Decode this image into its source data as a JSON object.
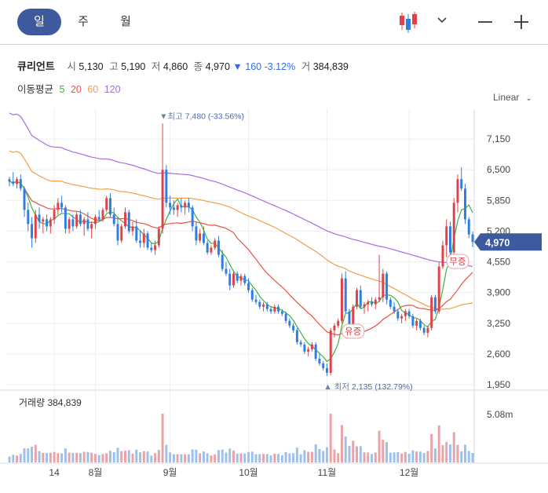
{
  "tabs": [
    {
      "id": "day",
      "label": "일",
      "active": true
    },
    {
      "id": "week",
      "label": "주",
      "active": false
    },
    {
      "id": "month",
      "label": "월",
      "active": false
    }
  ],
  "toolbar": {
    "chart_type_icon": "candlestick-icon",
    "dropdown_icon": "chevron-down-icon",
    "minus_icon": "minus-icon",
    "plus_icon": "plus-icon"
  },
  "stock": {
    "name": "큐리언트",
    "open_label": "시",
    "open": "5,130",
    "high_label": "고",
    "high": "5,190",
    "low_label": "저",
    "low": "4,860",
    "close_label": "종",
    "close": "4,970",
    "change_arrow": "▼",
    "change": "160",
    "change_pct": "-3.12%",
    "volume_label": "거",
    "volume": "384,839"
  },
  "moving_average": {
    "label": "이동평균",
    "periods": [
      {
        "period": "5",
        "color": "#3cb33c"
      },
      {
        "period": "20",
        "color": "#e8533f"
      },
      {
        "period": "60",
        "color": "#f0a048"
      },
      {
        "period": "120",
        "color": "#a96be0"
      }
    ]
  },
  "scale_mode": "Linear",
  "colors": {
    "up": "#e0424b",
    "down": "#2f7de1",
    "badge": "#3d5a9e",
    "grid": "#eceef1"
  },
  "chart_data": {
    "type": "candlestick",
    "price_axis": {
      "ticks": [
        "7,150",
        "6,500",
        "5,850",
        "5,200",
        "4,550",
        "3,900",
        "3,250",
        "2,600",
        "1,950"
      ],
      "tick_values": [
        7150,
        6500,
        5850,
        5200,
        4550,
        3900,
        3250,
        2600,
        1950
      ],
      "ylim": [
        1850,
        7800
      ]
    },
    "time_axis": {
      "ticks": [
        "14",
        "8월",
        "9월",
        "10월",
        "11월",
        "12월"
      ],
      "tick_index": [
        12,
        23,
        43,
        64,
        85,
        107
      ]
    },
    "current_price": "4,970",
    "annotations": {
      "high": {
        "arrow": "▼",
        "label": "최고",
        "value": "7,480",
        "pct": "(-33.56%)",
        "index": 41,
        "price": 7480
      },
      "low": {
        "arrow": "▲",
        "label": "최저",
        "value": "2,135",
        "pct": "(132.79%)",
        "index": 85,
        "price": 2135
      },
      "events": [
        {
          "label": "유증",
          "index": 92,
          "price": 3080
        },
        {
          "label": "무증",
          "index": 120,
          "price": 4560
        }
      ]
    },
    "volume_panel": {
      "label": "거래량",
      "value": "384,839",
      "axis_label": "5.08m",
      "axis_value": 5080000
    },
    "candles": [
      [
        6300,
        6350,
        6150,
        6250
      ],
      [
        6250,
        6450,
        6150,
        6200
      ],
      [
        6200,
        6350,
        6100,
        6300
      ],
      [
        6300,
        6400,
        6050,
        6100
      ],
      [
        6100,
        6150,
        5500,
        5650
      ],
      [
        5650,
        5800,
        5200,
        5350
      ],
      [
        5350,
        5500,
        4850,
        5050
      ],
      [
        5050,
        5650,
        4950,
        5550
      ],
      [
        5550,
        5700,
        5250,
        5400
      ],
      [
        5400,
        5500,
        5150,
        5450
      ],
      [
        5450,
        5550,
        5200,
        5300
      ],
      [
        5300,
        5500,
        5150,
        5450
      ],
      [
        5450,
        5750,
        5350,
        5650
      ],
      [
        5650,
        5900,
        5550,
        5800
      ],
      [
        5800,
        5950,
        5600,
        5700
      ],
      [
        5700,
        5750,
        5150,
        5250
      ],
      [
        5250,
        5500,
        5150,
        5450
      ],
      [
        5450,
        5550,
        5200,
        5300
      ],
      [
        5300,
        5600,
        5250,
        5550
      ],
      [
        5550,
        5650,
        5300,
        5350
      ],
      [
        5350,
        5500,
        5100,
        5450
      ],
      [
        5450,
        5600,
        5200,
        5250
      ],
      [
        5250,
        5400,
        5050,
        5350
      ],
      [
        5350,
        5550,
        5250,
        5500
      ],
      [
        5500,
        5650,
        5400,
        5450
      ],
      [
        5450,
        5700,
        5400,
        5650
      ],
      [
        5650,
        5950,
        5600,
        5900
      ],
      [
        5900,
        6000,
        5500,
        5550
      ],
      [
        5550,
        5700,
        5300,
        5350
      ],
      [
        5350,
        5500,
        4900,
        5000
      ],
      [
        5000,
        5350,
        4950,
        5300
      ],
      [
        5300,
        5700,
        5250,
        5600
      ],
      [
        5600,
        5650,
        5150,
        5200
      ],
      [
        5200,
        5400,
        5100,
        5300
      ],
      [
        5300,
        5450,
        4950,
        5000
      ],
      [
        5000,
        5200,
        4850,
        4950
      ],
      [
        4950,
        5250,
        4850,
        5150
      ],
      [
        5150,
        5200,
        4800,
        4850
      ],
      [
        4850,
        4950,
        4750,
        4800
      ],
      [
        4800,
        5000,
        4700,
        4900
      ],
      [
        4900,
        5300,
        4850,
        5250
      ],
      [
        5250,
        7480,
        5150,
        6500
      ],
      [
        6500,
        6600,
        5700,
        5800
      ],
      [
        5800,
        5950,
        5550,
        5700
      ],
      [
        5700,
        5850,
        5550,
        5650
      ],
      [
        5650,
        5800,
        5500,
        5750
      ],
      [
        5750,
        5900,
        5600,
        5700
      ],
      [
        5700,
        5850,
        5550,
        5800
      ],
      [
        5800,
        5900,
        5600,
        5700
      ],
      [
        5700,
        5750,
        5200,
        5300
      ],
      [
        5300,
        5400,
        4900,
        5000
      ],
      [
        5000,
        5250,
        4950,
        5150
      ],
      [
        5150,
        5300,
        4900,
        4950
      ],
      [
        4950,
        5000,
        4700,
        4750
      ],
      [
        4750,
        4900,
        4700,
        4850
      ],
      [
        4850,
        5050,
        4800,
        5000
      ],
      [
        5000,
        5100,
        4650,
        4700
      ],
      [
        4700,
        4800,
        4350,
        4400
      ],
      [
        4400,
        4550,
        4250,
        4300
      ],
      [
        4300,
        4400,
        3950,
        4050
      ],
      [
        4050,
        4350,
        4000,
        4300
      ],
      [
        4300,
        4350,
        4100,
        4150
      ],
      [
        4150,
        4300,
        4050,
        4250
      ],
      [
        4250,
        4300,
        4050,
        4100
      ],
      [
        4100,
        4200,
        3900,
        3950
      ],
      [
        3950,
        4000,
        3700,
        3750
      ],
      [
        3750,
        3850,
        3650,
        3700
      ],
      [
        3700,
        3750,
        3550,
        3600
      ],
      [
        3600,
        3700,
        3500,
        3650
      ],
      [
        3650,
        3700,
        3500,
        3550
      ],
      [
        3550,
        3600,
        3450,
        3500
      ],
      [
        3500,
        3650,
        3450,
        3600
      ],
      [
        3600,
        3650,
        3450,
        3500
      ],
      [
        3500,
        3550,
        3400,
        3450
      ],
      [
        3450,
        3500,
        3250,
        3300
      ],
      [
        3300,
        3350,
        3150,
        3200
      ],
      [
        3200,
        3250,
        3050,
        3100
      ],
      [
        3100,
        3150,
        2800,
        2850
      ],
      [
        2850,
        2900,
        2750,
        2800
      ],
      [
        2800,
        2850,
        2600,
        2650
      ],
      [
        2650,
        2750,
        2550,
        2700
      ],
      [
        2700,
        2850,
        2650,
        2800
      ],
      [
        2800,
        2850,
        2450,
        2500
      ],
      [
        2500,
        2600,
        2350,
        2400
      ],
      [
        2400,
        2450,
        2250,
        2300
      ],
      [
        2300,
        2400,
        2135,
        2200
      ],
      [
        2200,
        3150,
        2150,
        3100
      ],
      [
        3100,
        3250,
        2950,
        3200
      ],
      [
        3200,
        3350,
        3150,
        3300
      ],
      [
        3300,
        4300,
        3250,
        4200
      ],
      [
        4200,
        4350,
        3450,
        3500
      ],
      [
        3500,
        3550,
        3100,
        3150
      ],
      [
        3150,
        3650,
        3100,
        3600
      ],
      [
        3600,
        4000,
        3550,
        3950
      ],
      [
        3950,
        4050,
        3550,
        3600
      ],
      [
        3600,
        3700,
        3450,
        3650
      ],
      [
        3650,
        3750,
        3500,
        3700
      ],
      [
        3700,
        3800,
        3600,
        3650
      ],
      [
        3650,
        3800,
        3550,
        3750
      ],
      [
        3750,
        4700,
        3700,
        3800
      ],
      [
        3800,
        4400,
        3700,
        4300
      ],
      [
        4300,
        4350,
        3650,
        3750
      ],
      [
        3750,
        3800,
        3550,
        3600
      ],
      [
        3600,
        3700,
        3450,
        3500
      ],
      [
        3500,
        3550,
        3300,
        3350
      ],
      [
        3350,
        3450,
        3250,
        3400
      ],
      [
        3400,
        3550,
        3300,
        3500
      ],
      [
        3500,
        3550,
        3350,
        3400
      ],
      [
        3400,
        3450,
        3150,
        3200
      ],
      [
        3200,
        3350,
        3100,
        3300
      ],
      [
        3300,
        3350,
        3100,
        3150
      ],
      [
        3150,
        3200,
        3000,
        3050
      ],
      [
        3050,
        3200,
        2950,
        3150
      ],
      [
        3150,
        3850,
        3100,
        3800
      ],
      [
        3800,
        3850,
        3450,
        3500
      ],
      [
        3500,
        4550,
        3450,
        4450
      ],
      [
        4450,
        5000,
        4400,
        4900
      ],
      [
        4900,
        5450,
        4650,
        5300
      ],
      [
        5300,
        5400,
        4650,
        4750
      ],
      [
        4750,
        5900,
        4700,
        5800
      ],
      [
        5800,
        6400,
        5600,
        6300
      ],
      [
        6300,
        6550,
        6050,
        6100
      ],
      [
        6100,
        6200,
        5350,
        5450
      ],
      [
        5450,
        5500,
        5050,
        5130
      ],
      [
        5130,
        5190,
        4860,
        4970
      ]
    ]
  }
}
